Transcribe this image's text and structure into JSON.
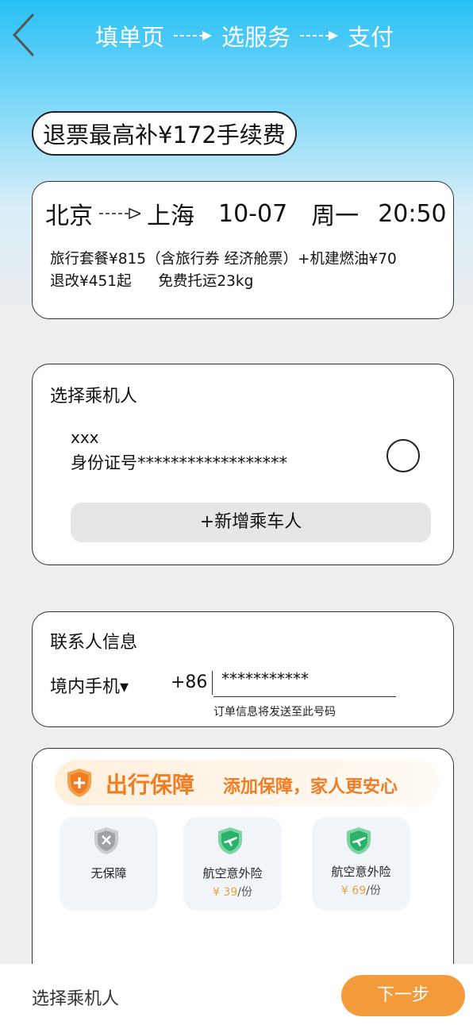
{
  "header": {
    "steps": [
      "填单页",
      "选服务",
      "支付"
    ]
  },
  "refund_badge": "退票最高补¥172手续费",
  "flight": {
    "from": "北京",
    "to": "上海",
    "date": "10-07",
    "weekday": "周一",
    "time": "20:50",
    "package_line": "旅行套餐¥815（含旅行券 经济舱票）+机建燃油¥70",
    "rebook": "退改¥451起",
    "baggage": "免费托运23kg"
  },
  "passenger": {
    "title": "选择乘机人",
    "name": "xxx",
    "id_label": "身份证号******************",
    "add_button": "+新增乘车人"
  },
  "contact": {
    "title": "联系人信息",
    "phone_type": "境内手机▾",
    "country_code": "+86",
    "phone_value": "***********",
    "hint": "订单信息将发送至此号码"
  },
  "insurance": {
    "title": "出行保障",
    "slogan": "添加保障，家人更安心",
    "plans": [
      {
        "label": "无保障",
        "icon": "gray-shield-x-icon"
      },
      {
        "label": "航空意外险",
        "price": "39",
        "currency": "¥",
        "unit": "/份",
        "icon": "green-shield-plane-icon"
      },
      {
        "label": "航空意外险",
        "price": "69",
        "currency": "¥",
        "unit": "/份",
        "icon": "green-shield-plane-icon"
      }
    ],
    "accent_color": "#ee7d23"
  },
  "bottom_bar": {
    "label": "选择乘机人",
    "next_button": "下一步",
    "button_color": "#f39a3a"
  }
}
